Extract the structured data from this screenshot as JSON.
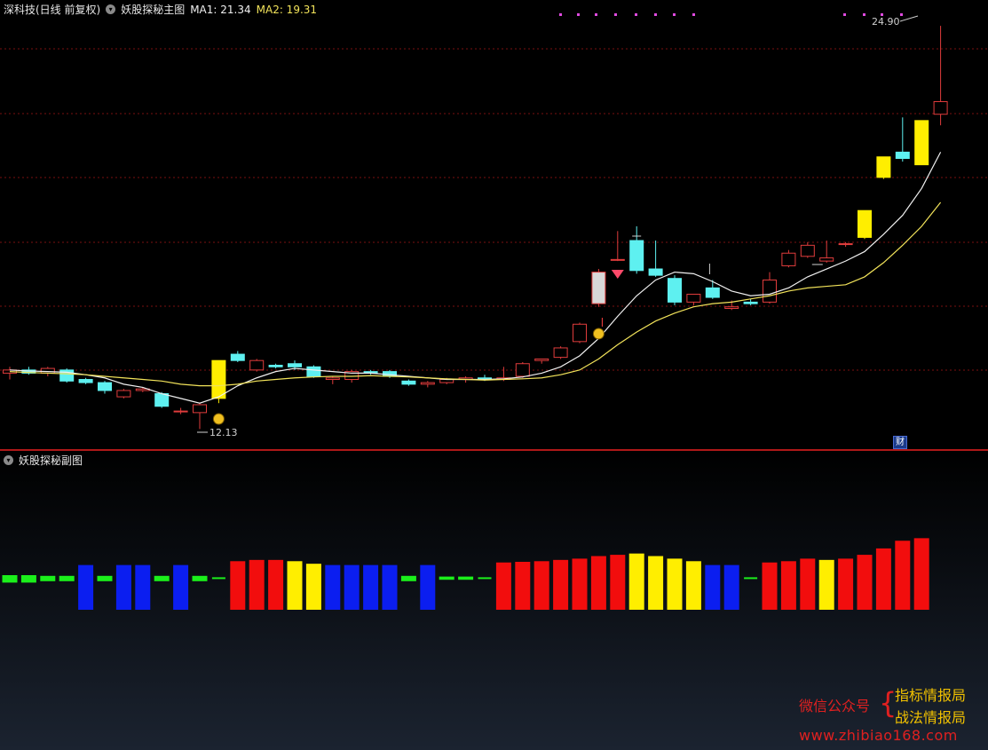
{
  "header": {
    "stock_name": "深科技(日线 前复权)",
    "indicator_title": "妖股探秘主图",
    "ma1_label": "MA1: 21.34",
    "ma2_label": "MA2: 19.31"
  },
  "sub_header": {
    "title": "妖股探秘副图"
  },
  "annotations": {
    "high_label": "24.90",
    "low_label": "12.13",
    "cai_badge": "财"
  },
  "watermark": {
    "wechat": "微信公众号",
    "line1": "指标情报局",
    "line2": "战法情报局",
    "site": "www.zhibiao168.com"
  },
  "colors": {
    "up": "#e03c3c",
    "down": "#5ef0f0",
    "yellow": "#ffee00",
    "blue": "#0b1ef0",
    "red": "#f20d0d",
    "green": "#1bf01b",
    "ma1": "#f0f0f0",
    "ma2": "#f2e35a",
    "grid": "#7a1010"
  },
  "chart_data": {
    "type": "candlestick",
    "price_range": [
      12.0,
      25.1
    ],
    "candles": [
      {
        "o": 13.9,
        "h": 14.1,
        "l": 13.7,
        "c": 14.0
      },
      {
        "o": 14.0,
        "h": 14.1,
        "l": 13.85,
        "c": 13.9
      },
      {
        "o": 13.9,
        "h": 14.1,
        "l": 13.8,
        "c": 14.05
      },
      {
        "o": 14.0,
        "h": 14.05,
        "l": 13.6,
        "c": 13.65
      },
      {
        "o": 13.7,
        "h": 13.75,
        "l": 13.55,
        "c": 13.6
      },
      {
        "o": 13.6,
        "h": 13.65,
        "l": 13.25,
        "c": 13.35
      },
      {
        "o": 13.15,
        "h": 13.4,
        "l": 13.1,
        "c": 13.35
      },
      {
        "o": 13.35,
        "h": 13.45,
        "l": 13.3,
        "c": 13.4
      },
      {
        "o": 13.25,
        "h": 13.3,
        "l": 12.8,
        "c": 12.85
      },
      {
        "o": 12.7,
        "h": 12.8,
        "l": 12.6,
        "c": 12.7
      },
      {
        "o": 12.65,
        "h": 12.95,
        "l": 12.13,
        "c": 12.9
      },
      {
        "o": 13.1,
        "h": 14.3,
        "l": 12.95,
        "c": 14.3,
        "yellow": true
      },
      {
        "o": 14.5,
        "h": 14.6,
        "l": 14.25,
        "c": 14.3
      },
      {
        "o": 14.0,
        "h": 14.35,
        "l": 13.95,
        "c": 14.3
      },
      {
        "o": 14.15,
        "h": 14.2,
        "l": 14.05,
        "c": 14.1
      },
      {
        "o": 14.2,
        "h": 14.3,
        "l": 14.0,
        "c": 14.1
      },
      {
        "o": 14.1,
        "h": 14.15,
        "l": 13.75,
        "c": 13.8
      },
      {
        "o": 13.7,
        "h": 13.8,
        "l": 13.55,
        "c": 13.75
      },
      {
        "o": 13.7,
        "h": 14.0,
        "l": 13.6,
        "c": 13.95
      },
      {
        "o": 13.95,
        "h": 14.0,
        "l": 13.85,
        "c": 13.9
      },
      {
        "o": 13.95,
        "h": 14.0,
        "l": 13.75,
        "c": 13.8
      },
      {
        "o": 13.65,
        "h": 13.7,
        "l": 13.5,
        "c": 13.55
      },
      {
        "o": 13.55,
        "h": 13.65,
        "l": 13.45,
        "c": 13.6
      },
      {
        "o": 13.6,
        "h": 13.75,
        "l": 13.55,
        "c": 13.7
      },
      {
        "o": 13.7,
        "h": 13.8,
        "l": 13.6,
        "c": 13.75
      },
      {
        "o": 13.75,
        "h": 13.85,
        "l": 13.65,
        "c": 13.7
      },
      {
        "o": 13.7,
        "h": 14.1,
        "l": 13.65,
        "c": 13.75
      },
      {
        "o": 13.8,
        "h": 14.25,
        "l": 13.75,
        "c": 14.2
      },
      {
        "o": 14.3,
        "h": 14.35,
        "l": 14.2,
        "c": 14.35
      },
      {
        "o": 14.4,
        "h": 14.75,
        "l": 14.35,
        "c": 14.7
      },
      {
        "o": 14.9,
        "h": 15.5,
        "l": 14.85,
        "c": 15.45
      },
      {
        "o": 16.1,
        "h": 17.2,
        "l": 16.0,
        "c": 17.1,
        "white": true
      },
      {
        "o": 17.5,
        "h": 18.4,
        "l": 17.45,
        "c": 17.5
      },
      {
        "o": 18.1,
        "h": 18.55,
        "l": 17.05,
        "c": 17.15
      },
      {
        "o": 17.2,
        "h": 18.1,
        "l": 16.95,
        "c": 17.0
      },
      {
        "o": 16.9,
        "h": 17.0,
        "l": 16.05,
        "c": 16.15
      },
      {
        "o": 16.15,
        "h": 16.4,
        "l": 16.05,
        "c": 16.4
      },
      {
        "o": 16.6,
        "h": 16.85,
        "l": 16.25,
        "c": 16.3
      },
      {
        "o": 15.95,
        "h": 16.2,
        "l": 15.9,
        "c": 16.0
      },
      {
        "o": 16.15,
        "h": 16.25,
        "l": 16.05,
        "c": 16.1
      },
      {
        "o": 16.15,
        "h": 17.1,
        "l": 16.1,
        "c": 16.85
      },
      {
        "o": 17.3,
        "h": 17.8,
        "l": 17.25,
        "c": 17.7
      },
      {
        "o": 17.6,
        "h": 18.05,
        "l": 17.55,
        "c": 17.95
      },
      {
        "o": 17.45,
        "h": 18.1,
        "l": 17.4,
        "c": 17.55
      },
      {
        "o": 18.0,
        "h": 18.05,
        "l": 17.9,
        "c": 18.0
      },
      {
        "o": 18.2,
        "h": 19.05,
        "l": 18.15,
        "c": 19.05,
        "yellow": true
      },
      {
        "o": 20.1,
        "h": 20.75,
        "l": 20.05,
        "c": 20.75,
        "yellow": true
      },
      {
        "o": 20.9,
        "h": 22.0,
        "l": 20.6,
        "c": 20.7
      },
      {
        "o": 20.5,
        "h": 21.9,
        "l": 20.5,
        "c": 21.9,
        "yellow": true
      },
      {
        "o": 22.1,
        "h": 24.9,
        "l": 21.75,
        "c": 22.5
      }
    ],
    "ma1": [
      14.0,
      13.97,
      13.95,
      13.93,
      13.85,
      13.75,
      13.55,
      13.45,
      13.25,
      13.1,
      12.95,
      13.15,
      13.5,
      13.75,
      13.95,
      14.05,
      14.0,
      13.95,
      13.9,
      13.9,
      13.85,
      13.8,
      13.75,
      13.7,
      13.7,
      13.7,
      13.72,
      13.78,
      13.9,
      14.1,
      14.45,
      15.0,
      15.7,
      16.35,
      16.85,
      17.1,
      17.05,
      16.8,
      16.5,
      16.35,
      16.4,
      16.6,
      16.95,
      17.2,
      17.45,
      17.75,
      18.3,
      18.9,
      19.75,
      20.9
    ],
    "ma2": [
      13.95,
      13.92,
      13.9,
      13.88,
      13.85,
      13.8,
      13.75,
      13.7,
      13.65,
      13.55,
      13.5,
      13.5,
      13.55,
      13.65,
      13.7,
      13.75,
      13.78,
      13.8,
      13.8,
      13.82,
      13.8,
      13.78,
      13.75,
      13.72,
      13.7,
      13.68,
      13.7,
      13.72,
      13.75,
      13.85,
      14.0,
      14.35,
      14.8,
      15.2,
      15.55,
      15.8,
      16.0,
      16.1,
      16.15,
      16.25,
      16.35,
      16.5,
      16.6,
      16.65,
      16.7,
      16.95,
      17.4,
      17.95,
      18.55,
      19.31
    ],
    "sub_bars": [
      {
        "t": "g",
        "v": 0.14
      },
      {
        "t": "g",
        "v": 0.14
      },
      {
        "t": "g",
        "v": 0.1
      },
      {
        "t": "g",
        "v": 0.1
      },
      {
        "t": "b",
        "v": 0.7
      },
      {
        "t": "g",
        "v": 0.1
      },
      {
        "t": "b",
        "v": 0.7
      },
      {
        "t": "b",
        "v": 0.7
      },
      {
        "t": "g",
        "v": 0.1
      },
      {
        "t": "b",
        "v": 0.7
      },
      {
        "t": "g",
        "v": 0.1
      },
      {
        "t": "g",
        "v": 0.02
      },
      {
        "t": "r",
        "v": 0.76
      },
      {
        "t": "r",
        "v": 0.78
      },
      {
        "t": "r",
        "v": 0.78
      },
      {
        "t": "y",
        "v": 0.76
      },
      {
        "t": "y",
        "v": 0.72
      },
      {
        "t": "b",
        "v": 0.7
      },
      {
        "t": "b",
        "v": 0.7
      },
      {
        "t": "b",
        "v": 0.7
      },
      {
        "t": "b",
        "v": 0.7
      },
      {
        "t": "g",
        "v": 0.1
      },
      {
        "t": "b",
        "v": 0.7
      },
      {
        "t": "g",
        "v": 0.06
      },
      {
        "t": "g",
        "v": 0.06
      },
      {
        "t": "g",
        "v": 0.02
      },
      {
        "t": "r",
        "v": 0.74
      },
      {
        "t": "r",
        "v": 0.75
      },
      {
        "t": "r",
        "v": 0.76
      },
      {
        "t": "r",
        "v": 0.78
      },
      {
        "t": "r",
        "v": 0.8
      },
      {
        "t": "r",
        "v": 0.84
      },
      {
        "t": "r",
        "v": 0.86
      },
      {
        "t": "y",
        "v": 0.88
      },
      {
        "t": "y",
        "v": 0.84
      },
      {
        "t": "y",
        "v": 0.8
      },
      {
        "t": "y",
        "v": 0.76
      },
      {
        "t": "b",
        "v": 0.7
      },
      {
        "t": "b",
        "v": 0.7
      },
      {
        "t": "g",
        "v": 0.02
      },
      {
        "t": "r",
        "v": 0.74
      },
      {
        "t": "r",
        "v": 0.76
      },
      {
        "t": "r",
        "v": 0.8
      },
      {
        "t": "y",
        "v": 0.78
      },
      {
        "t": "r",
        "v": 0.8
      },
      {
        "t": "r",
        "v": 0.86
      },
      {
        "t": "r",
        "v": 0.96
      },
      {
        "t": "r",
        "v": 1.08
      },
      {
        "t": "r",
        "v": 1.12
      }
    ]
  }
}
